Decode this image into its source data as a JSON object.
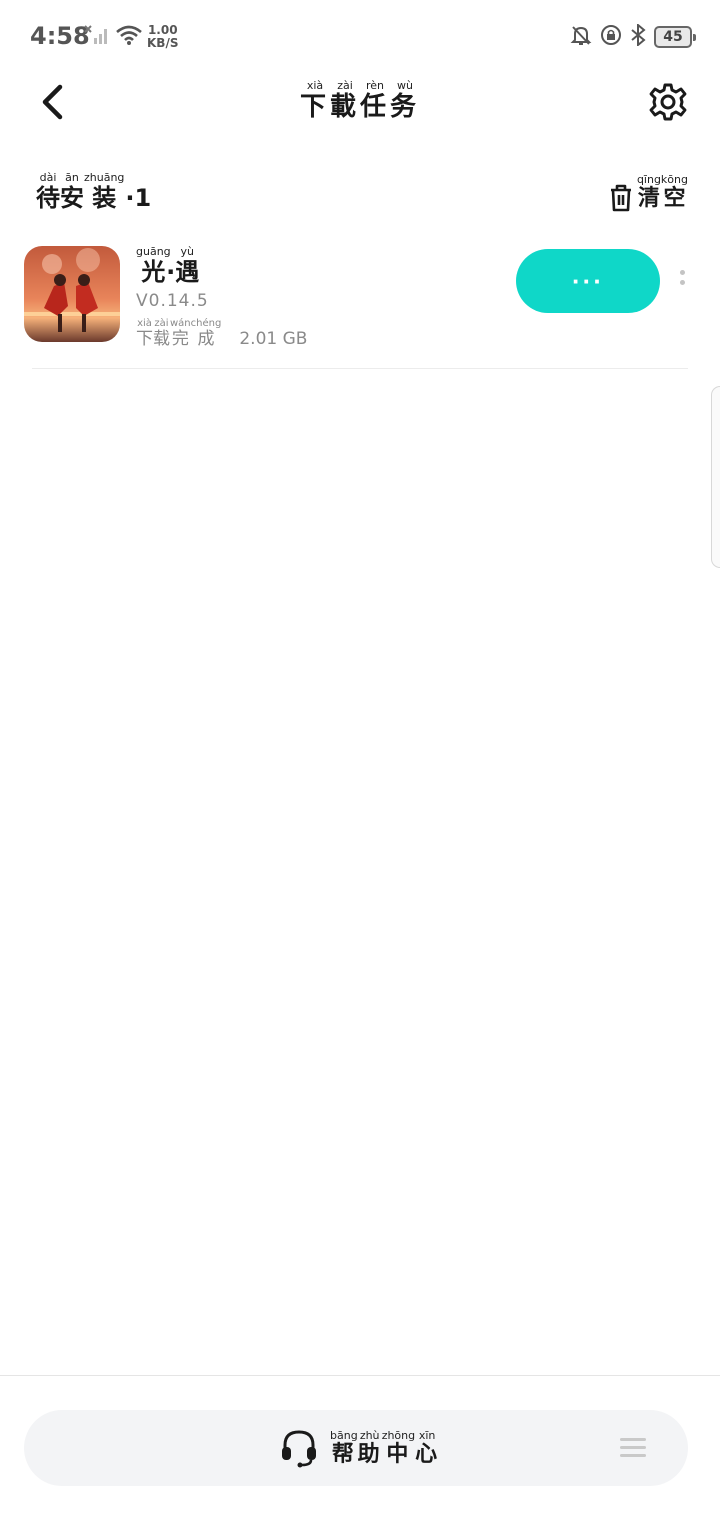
{
  "status_bar": {
    "time": "4:58",
    "speed_value": "1.00",
    "speed_unit": "KB/S",
    "battery": "45"
  },
  "header": {
    "title": "下载任务",
    "title_pinyin": [
      "xià",
      "zài",
      "rèn",
      "wù"
    ],
    "title_chars": [
      "下",
      "載",
      "任",
      "务"
    ]
  },
  "section": {
    "chars": [
      "待",
      "安",
      "装"
    ],
    "pinyin": [
      "dài",
      "ān",
      "zhuāng"
    ],
    "count_text": "·1",
    "clear_chars": [
      "清",
      "空"
    ],
    "clear_pinyin": [
      "qīng",
      "kōng"
    ]
  },
  "task": {
    "name_chars": [
      "光",
      "遇"
    ],
    "name_pinyin": [
      "guāng",
      "yù"
    ],
    "name_separator": "·",
    "version": "V0.14.5",
    "status_chars": [
      "下",
      "载",
      "完",
      "成"
    ],
    "status_pinyin": [
      "xià",
      "zài",
      "wán",
      "chéng"
    ],
    "size": "2.01 GB",
    "action_label": "···"
  },
  "help": {
    "chars": [
      "帮",
      "助",
      "中",
      "心"
    ],
    "pinyin": [
      "bāng",
      "zhù",
      "zhōng",
      "xīn"
    ]
  },
  "colors": {
    "accent": "#0fd7c8",
    "muted_text": "#8a8a8a",
    "help_bg": "#f3f4f6"
  }
}
